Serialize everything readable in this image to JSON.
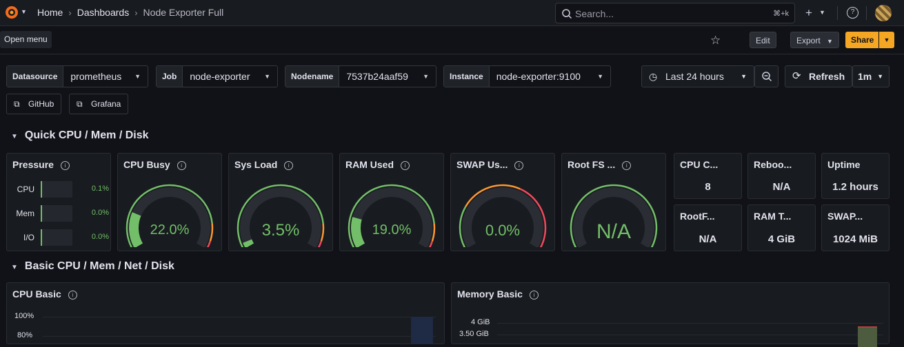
{
  "topbar": {
    "breadcrumbs": [
      "Home",
      "Dashboards",
      "Node Exporter Full"
    ],
    "search_placeholder": "Search...",
    "search_shortcut": "⌘+k",
    "logo_icon": "grafana-logo-icon",
    "tooltip": "Open menu"
  },
  "toolbar": {
    "edit": "Edit",
    "export": "Export",
    "share": "Share"
  },
  "variables": [
    {
      "label": "Datasource",
      "value": "prometheus"
    },
    {
      "label": "Job",
      "value": "node-exporter"
    },
    {
      "label": "Nodename",
      "value": "7537b24aaf59"
    },
    {
      "label": "Instance",
      "value": "node-exporter:9100"
    }
  ],
  "time": {
    "range": "Last 24 hours",
    "refresh": "Refresh",
    "interval": "1m"
  },
  "links": [
    "GitHub",
    "Grafana"
  ],
  "rows": [
    "Quick CPU / Mem / Disk",
    "Basic CPU / Mem / Net / Disk"
  ],
  "pressure": {
    "title": "Pressure",
    "items": [
      {
        "label": "CPU",
        "value": "0.1%"
      },
      {
        "label": "Mem",
        "value": "0.0%"
      },
      {
        "label": "I/O",
        "value": "0.0%"
      }
    ]
  },
  "gauges": [
    {
      "title": "CPU Busy",
      "value": "22.0%",
      "fraction": 0.22
    },
    {
      "title": "Sys Load",
      "value": "3.5%",
      "fraction": 0.035
    },
    {
      "title": "RAM Used",
      "value": "19.0%",
      "fraction": 0.19
    },
    {
      "title": "SWAP Us...",
      "value": "0.0%",
      "fraction": 0.0
    },
    {
      "title": "Root FS ...",
      "value": "N/A",
      "fraction": 0.0
    }
  ],
  "stats": [
    {
      "title": "CPU C...",
      "value": "8"
    },
    {
      "title": "Reboo...",
      "value": "N/A"
    },
    {
      "title": "Uptime",
      "value": "1.2 hours"
    },
    {
      "title": "RootF...",
      "value": "N/A"
    },
    {
      "title": "RAM T...",
      "value": "4 GiB"
    },
    {
      "title": "SWAP...",
      "value": "1024 MiB"
    }
  ],
  "cpu_basic": {
    "title": "CPU Basic",
    "ticks": [
      "100%",
      "80%"
    ]
  },
  "memory_basic": {
    "title": "Memory Basic",
    "ticks": [
      "4 GiB",
      "3.50 GiB"
    ]
  },
  "colors": {
    "green": "#73bf69",
    "orange": "#ff9830",
    "red": "#f2495c",
    "accent": "#f5a623"
  }
}
